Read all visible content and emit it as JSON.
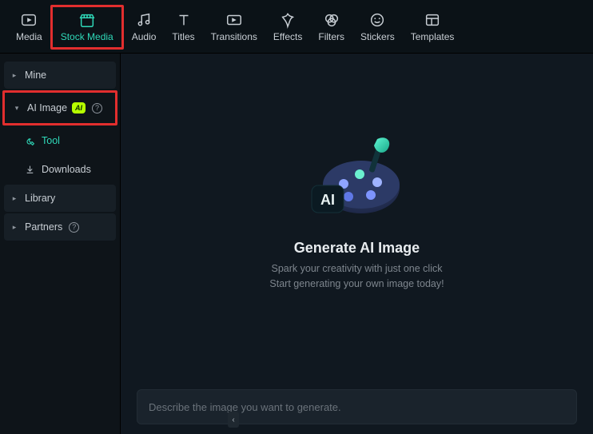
{
  "top_tabs": {
    "media": {
      "label": "Media"
    },
    "stock_media": {
      "label": "Stock Media"
    },
    "audio": {
      "label": "Audio"
    },
    "titles": {
      "label": "Titles"
    },
    "transitions": {
      "label": "Transitions"
    },
    "effects": {
      "label": "Effects"
    },
    "filters": {
      "label": "Filters"
    },
    "stickers": {
      "label": "Stickers"
    },
    "templates": {
      "label": "Templates"
    }
  },
  "sidebar": {
    "mine": {
      "label": "Mine"
    },
    "ai_image": {
      "label": "AI Image",
      "badge": "AI"
    },
    "tool": {
      "label": "Tool"
    },
    "downloads": {
      "label": "Downloads"
    },
    "library": {
      "label": "Library"
    },
    "partners": {
      "label": "Partners"
    }
  },
  "hero": {
    "badge_text": "AI",
    "title": "Generate AI Image",
    "subtitle_line1": "Spark your creativity with just one click",
    "subtitle_line2": "Start generating your own image today!"
  },
  "prompt": {
    "placeholder": "Describe the image you want to generate."
  },
  "colors": {
    "accent": "#2fd9b9",
    "highlight": "#e22e2e"
  }
}
